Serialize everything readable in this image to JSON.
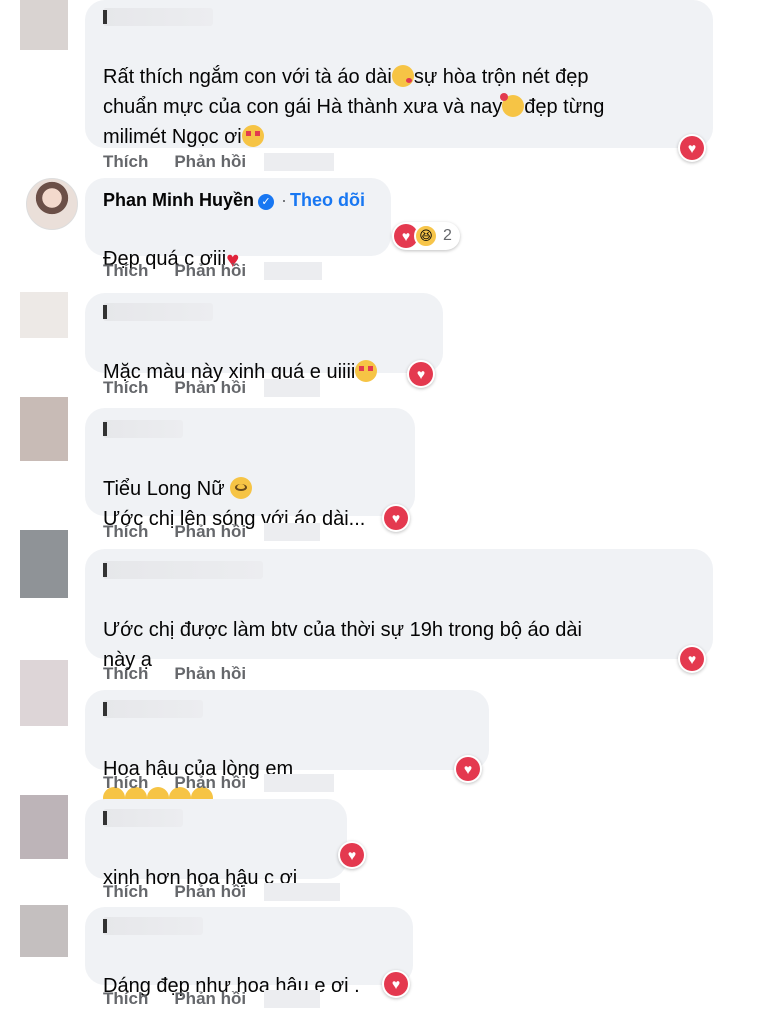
{
  "actions": {
    "like": "Thích",
    "reply": "Phản hồi"
  },
  "comments": [
    {
      "text": "Rất thích ngắm con với tà áo dài",
      "text2": "sự hòa trộn nét đẹp",
      "text3": "chuẩn mực của con gái Hà thành xưa và nay",
      "text4": "đẹp từng",
      "text5": "milimét Ngọc ơi"
    },
    {
      "commenter": "Phan Minh Huyền",
      "follow": "Theo dõi",
      "text": "Đẹp quá c ơiii",
      "reaction_count": "2"
    },
    {
      "text": "Mặc màu này xinh quá e uiiii"
    },
    {
      "text": "Tiểu Long Nữ",
      "text2": "Ước chị lên sóng với áo dài..."
    },
    {
      "text": "Ước chị được làm btv của thời sự 19h trong bộ áo dài",
      "text2": "này ạ"
    },
    {
      "text": "Hoa hậu của lòng em"
    },
    {
      "text": "xinh hơn hoa hậu c ơi"
    },
    {
      "text": "Dáng đẹp như hoa hậu e ơi ."
    }
  ],
  "colors": {
    "bubble": "#f0f2f5",
    "link": "#1877f2",
    "love": "#e4394f",
    "meta": "#65676b"
  }
}
